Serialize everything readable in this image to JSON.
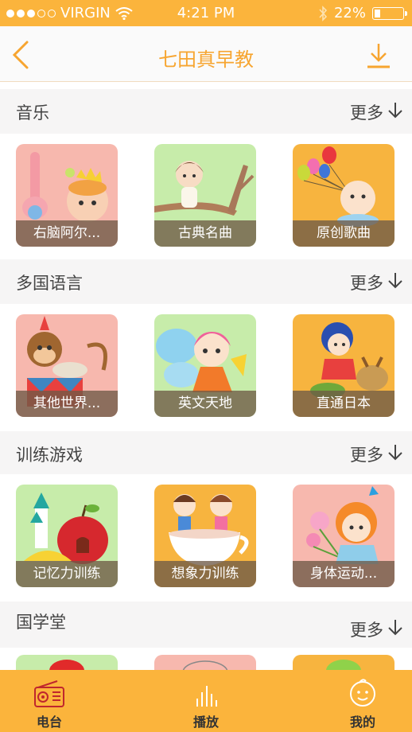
{
  "status": {
    "carrier": "VIRGIN",
    "time": "4:21 PM",
    "battery_text": "22%",
    "battery_level": 0.22
  },
  "header": {
    "title": "七田真早教",
    "back_icon": "back-chevron-icon",
    "download_icon": "download-icon"
  },
  "sections": [
    {
      "name": "音乐",
      "more": "更多",
      "items": [
        {
          "caption": "右脑阿尔...",
          "art": "girl-with-drink-art"
        },
        {
          "caption": "古典名曲",
          "art": "girl-on-branch-art"
        },
        {
          "caption": "原创歌曲",
          "art": "baby-with-balloons-art"
        }
      ]
    },
    {
      "name": "多国语言",
      "more": "更多",
      "items": [
        {
          "caption": "其他世界...",
          "art": "monkey-drummer-art"
        },
        {
          "caption": "英文天地",
          "art": "fairy-girl-art"
        },
        {
          "caption": "直通日本",
          "art": "girl-with-deer-art"
        }
      ]
    },
    {
      "name": "训练游戏",
      "more": "更多",
      "items": [
        {
          "caption": "记忆力训练",
          "art": "apple-house-art"
        },
        {
          "caption": "想象力训练",
          "art": "kids-in-teacup-art"
        },
        {
          "caption": "身体运动...",
          "art": "girl-with-flowers-art"
        }
      ]
    },
    {
      "name": "国学堂",
      "more": "更多",
      "items": []
    }
  ],
  "tabs": [
    {
      "label": "电台",
      "icon": "radio-icon",
      "active": true
    },
    {
      "label": "播放",
      "icon": "equalizer-icon",
      "active": false
    },
    {
      "label": "我的",
      "icon": "baby-face-icon",
      "active": false
    }
  ],
  "colors": {
    "accent": "#fbb43c",
    "title": "#f7a530",
    "active_tab": "#c0262d"
  }
}
